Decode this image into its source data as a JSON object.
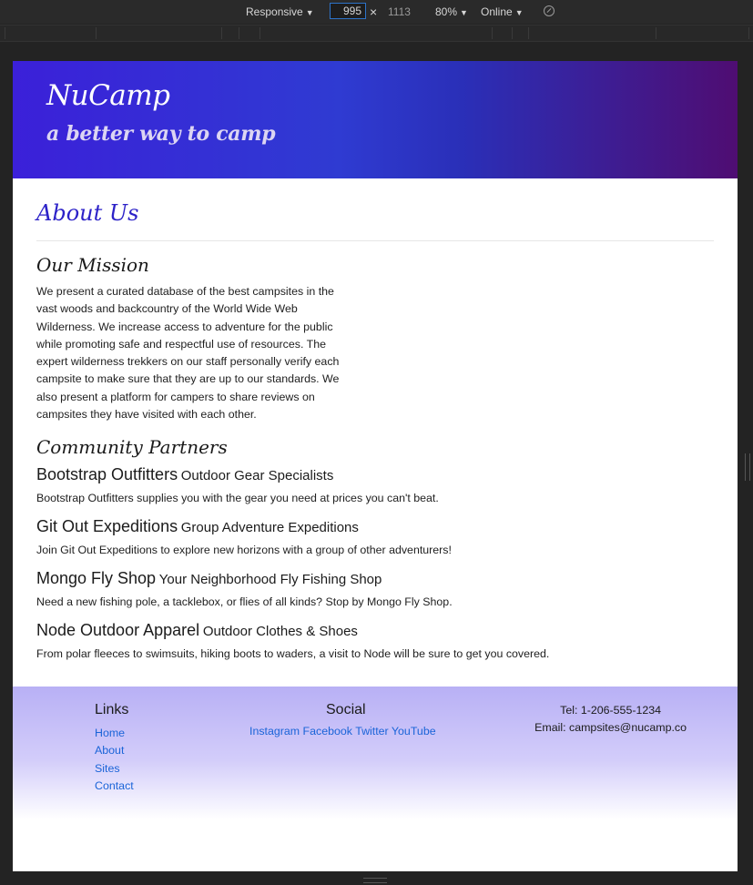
{
  "devtools": {
    "device": "Responsive",
    "width": "995",
    "height": "1113",
    "zoom": "80%",
    "network": "Online",
    "close_glyph": "×"
  },
  "site": {
    "brand": "NuCamp",
    "tagline": "a better way to camp"
  },
  "about": {
    "title": "About Us",
    "mission_heading": "Our Mission",
    "mission_text": "We present a curated database of the best campsites in the vast woods and backcountry of the World Wide Web Wilderness. We increase access to adventure for the public while promoting safe and respectful use of resources. The expert wilderness trekkers on our staff personally verify each campsite to make sure that they are up to our standards. We also present a platform for campers to share reviews on campsites they have visited with each other.",
    "partners_heading": "Community Partners",
    "partners": [
      {
        "name": "Bootstrap Outfitters",
        "subtitle": "Outdoor Gear Specialists",
        "desc": "Bootstrap Outfitters supplies you with the gear you need at prices you can't beat."
      },
      {
        "name": "Git Out Expeditions",
        "subtitle": "Group Adventure Expeditions",
        "desc": "Join Git Out Expeditions to explore new horizons with a group of other adventurers!"
      },
      {
        "name": "Mongo Fly Shop",
        "subtitle": "Your Neighborhood Fly Fishing Shop",
        "desc": "Need a new fishing pole, a tacklebox, or flies of all kinds? Stop by Mongo Fly Shop."
      },
      {
        "name": "Node Outdoor Apparel",
        "subtitle": "Outdoor Clothes & Shoes",
        "desc": "From polar fleeces to swimsuits, hiking boots to waders, a visit to Node will be sure to get you covered."
      }
    ]
  },
  "footer": {
    "links_heading": "Links",
    "links": [
      "Home",
      "About",
      "Sites",
      "Contact"
    ],
    "social_heading": "Social",
    "social": [
      "Instagram",
      "Facebook",
      "Twitter",
      "YouTube"
    ],
    "tel": "Tel: 1-206-555-1234",
    "email": "Email: campsites@nucamp.co"
  },
  "colors": {
    "gradient_start": "#3b20d9",
    "gradient_end": "#4f0d72",
    "heading_blue": "#2c22c8",
    "link_blue": "#1a64d8"
  }
}
